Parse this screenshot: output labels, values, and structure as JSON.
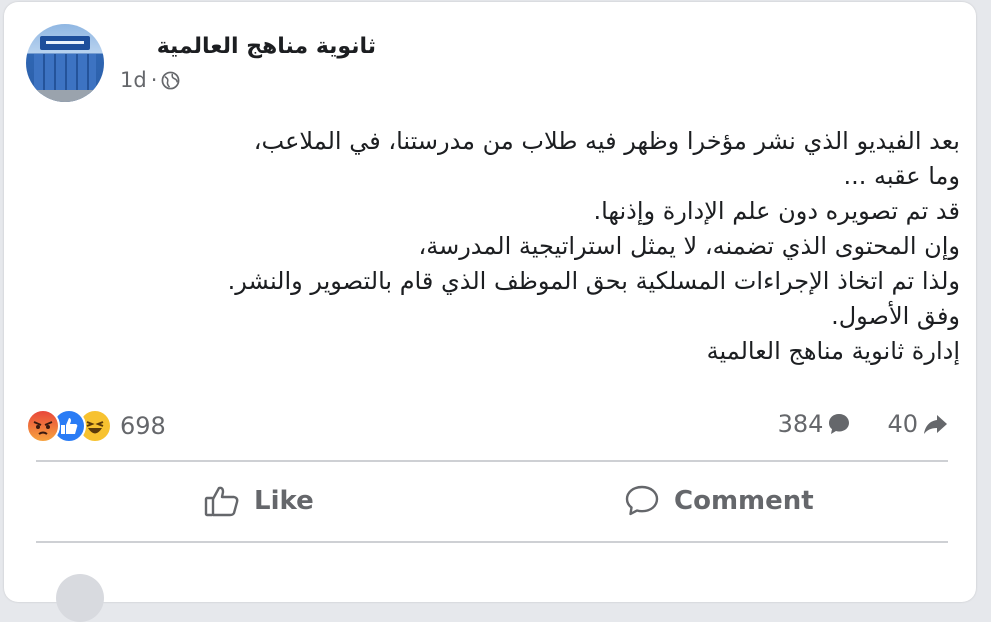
{
  "post": {
    "page_name": "ثانوية مناهج العالمية",
    "time": "1d",
    "separator": "·",
    "privacy_icon": "globe-icon",
    "text": "بعد الفيديو الذي نشر مؤخرا وظهر فيه طلاب من مدرستنا، في الملاعب،\nوما عقبه ...\nقد تم تصويره دون علم الإدارة وإذنها.\nوإن المحتوى الذي تضمنه، لا يمثل استراتيجية المدرسة،\nولذا تم اتخاذ الإجراءات المسلكية بحق الموظف الذي قام بالتصوير والنشر.\nوفق الأصول.\nإدارة ثانوية مناهج العالمية"
  },
  "stats": {
    "reactions_count": "698",
    "reaction_icons": [
      "angry-icon",
      "like-icon",
      "haha-icon"
    ],
    "comments_count": "384",
    "shares_count": "40"
  },
  "actions": {
    "like_label": "Like",
    "comment_label": "Comment"
  },
  "colors": {
    "text": "#1c1e21",
    "secondary": "#65676b",
    "like_blue": "#2a7cf5",
    "divider": "#ced0d4"
  }
}
